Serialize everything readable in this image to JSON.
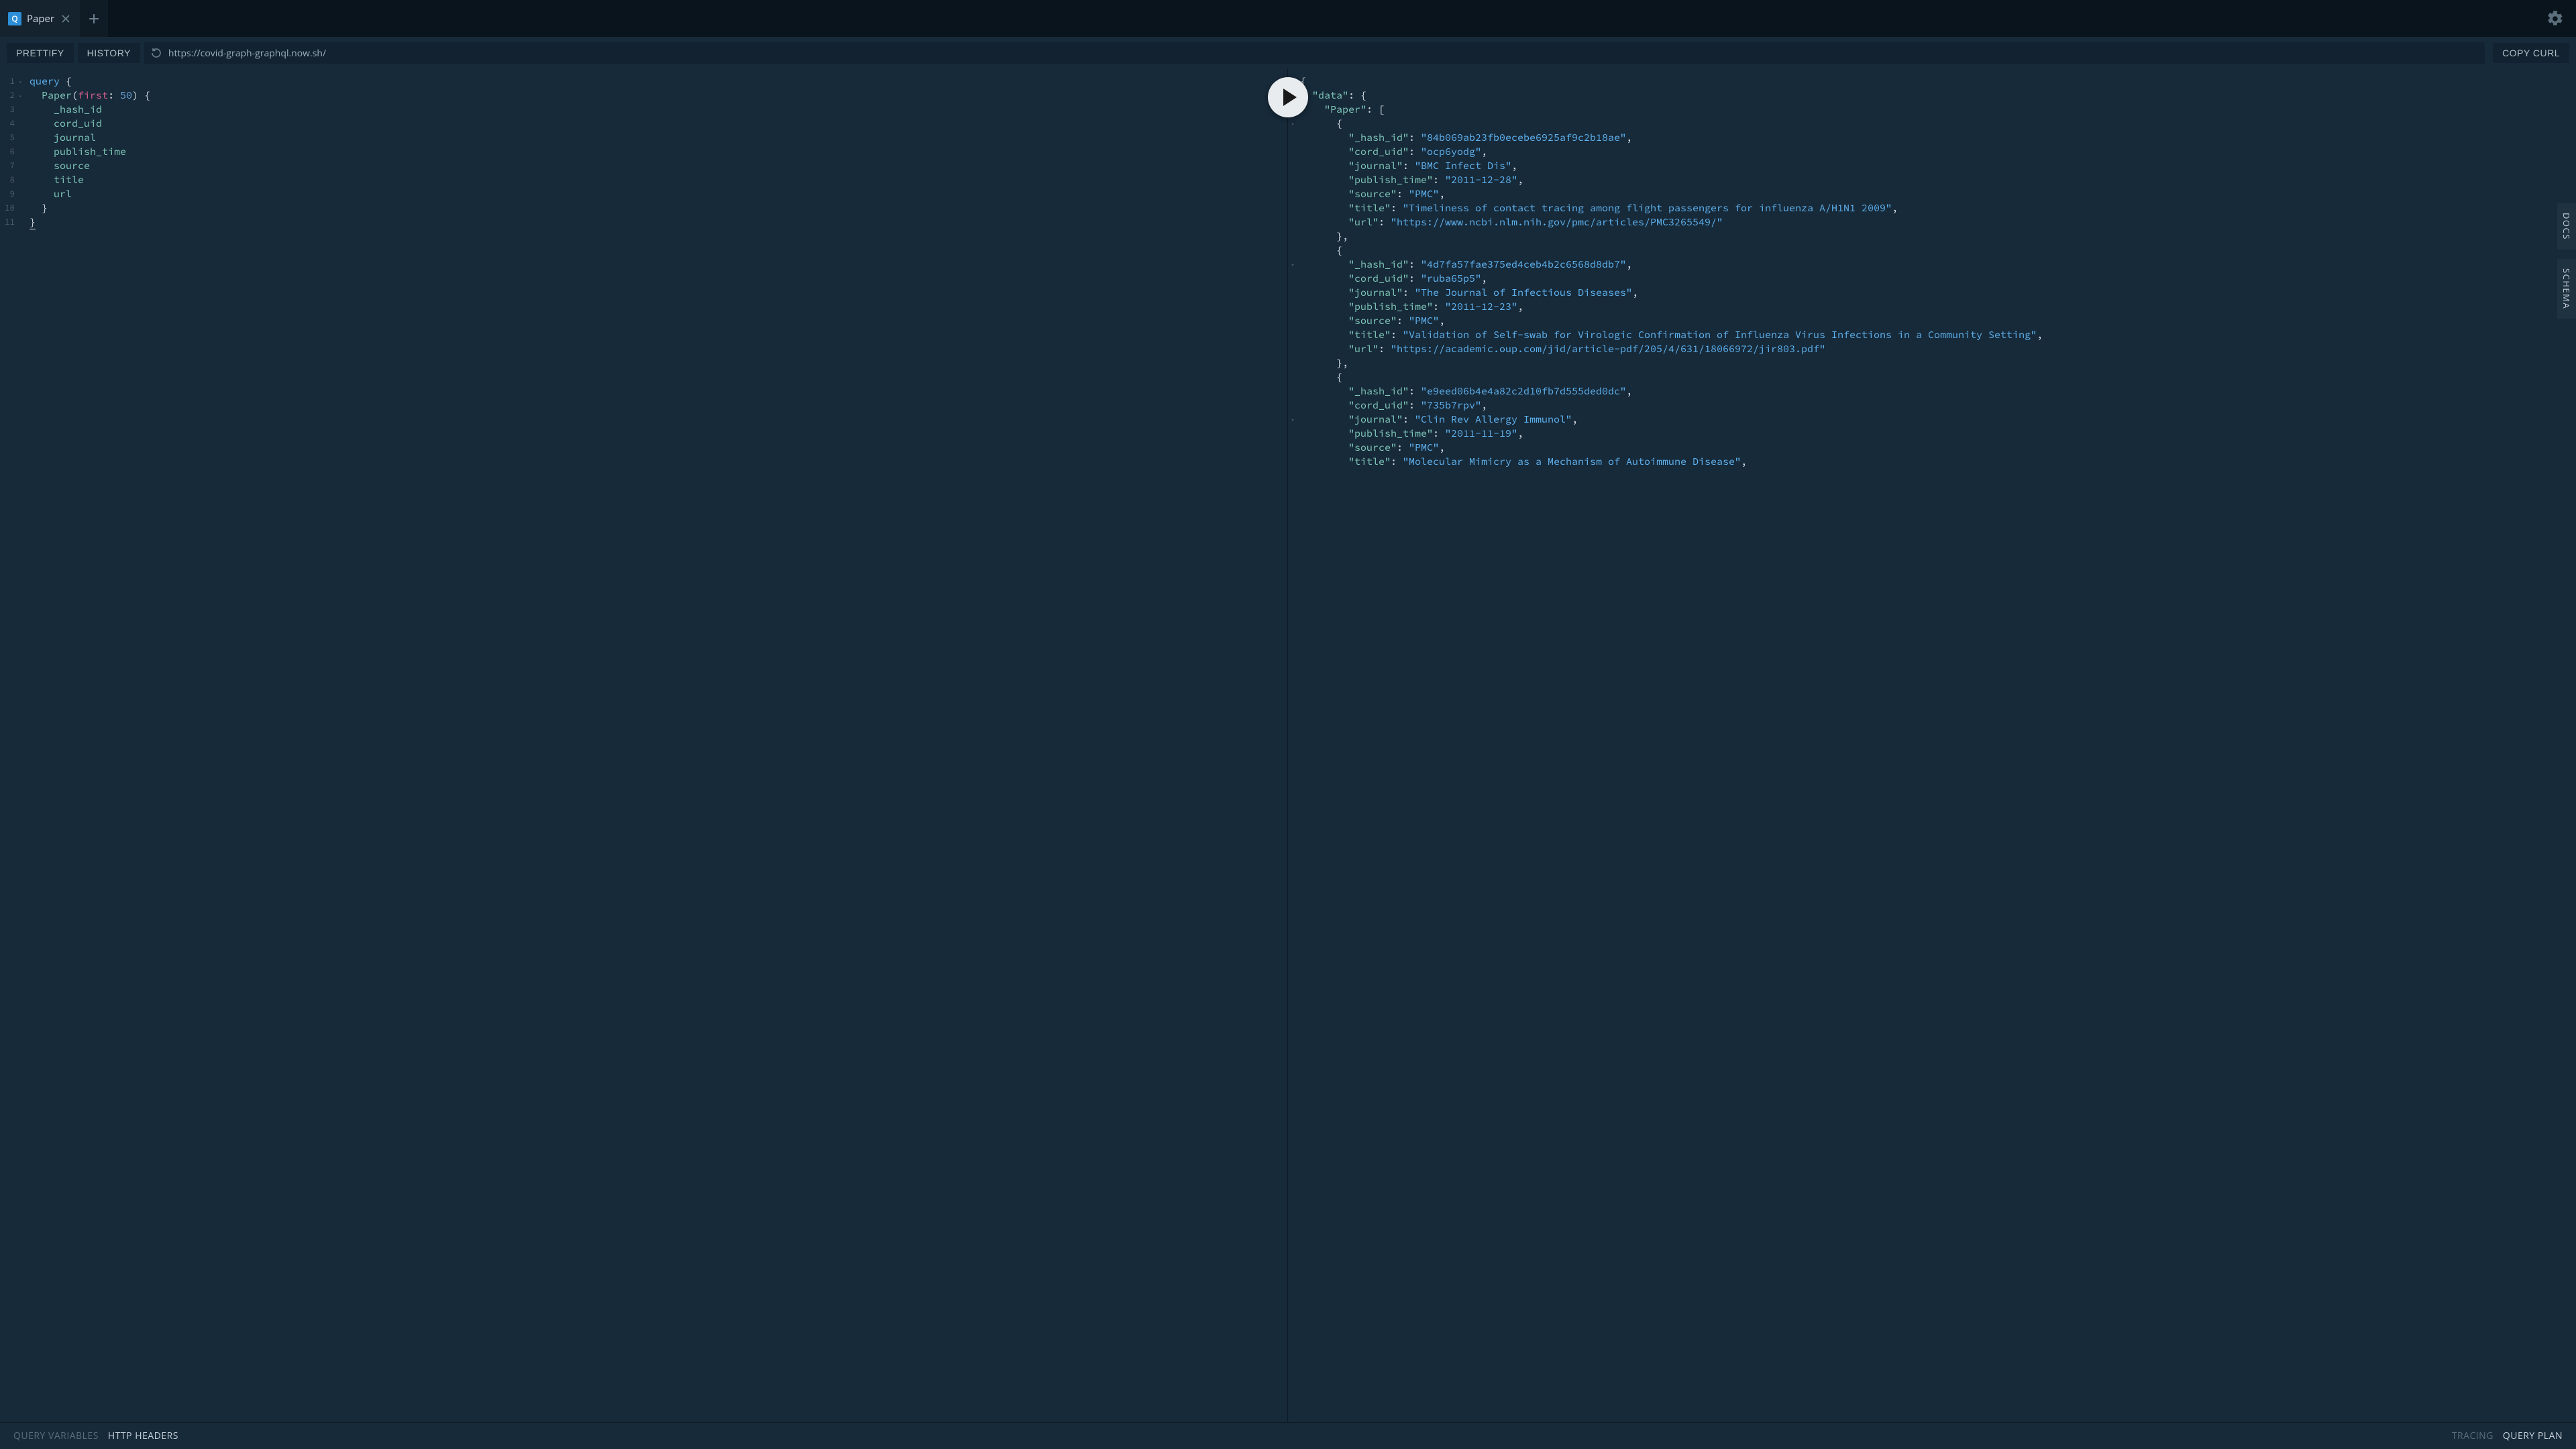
{
  "tab": {
    "title": "Paper",
    "icon_letter": "Q"
  },
  "toolbar": {
    "prettify": "PRETTIFY",
    "history": "HISTORY",
    "url": "https://covid-graph-graphql.now.sh/",
    "copy_curl": "COPY CURL"
  },
  "editor": {
    "lines": [
      "1",
      "2",
      "3",
      "4",
      "5",
      "6",
      "7",
      "8",
      "9",
      "10",
      "11"
    ],
    "query_kw": "query",
    "entity": "Paper",
    "first_arg": "first",
    "first_val": "50",
    "fields": [
      "_hash_id",
      "cord_uid",
      "journal",
      "publish_time",
      "source",
      "title",
      "url"
    ]
  },
  "result": {
    "data_key": "data",
    "paper_key": "Paper",
    "rows": [
      {
        "_hash_id": "84b069ab23fb0ecebe6925af9c2b18ae",
        "cord_uid": "ocp6yodg",
        "journal": "BMC Infect Dis",
        "publish_time": "2011-12-28",
        "source": "PMC",
        "title": "Timeliness of contact tracing among flight passengers for influenza A/H1N1 2009",
        "url": "https://www.ncbi.nlm.nih.gov/pmc/articles/PMC3265549/"
      },
      {
        "_hash_id": "4d7fa57fae375ed4ceb4b2c6568d8db7",
        "cord_uid": "ruba65p5",
        "journal": "The Journal of Infectious Diseases",
        "publish_time": "2011-12-23",
        "source": "PMC",
        "title": "Validation of Self-swab for Virologic Confirmation of Influenza Virus Infections in a Community Setting",
        "url": "https://academic.oup.com/jid/article-pdf/205/4/631/18066972/jir803.pdf"
      },
      {
        "_hash_id": "e9eed06b4e4a82c2d10fb7d555ded0dc",
        "cord_uid": "735b7rpv",
        "journal": "Clin Rev Allergy Immunol",
        "publish_time": "2011-11-19",
        "source": "PMC",
        "title": "Molecular Mimicry as a Mechanism of Autoimmune Disease"
      }
    ]
  },
  "side": {
    "docs": "DOCS",
    "schema": "SCHEMA"
  },
  "bottom": {
    "query_variables": "QUERY VARIABLES",
    "http_headers": "HTTP HEADERS",
    "tracing": "TRACING",
    "query_plan": "QUERY PLAN"
  }
}
